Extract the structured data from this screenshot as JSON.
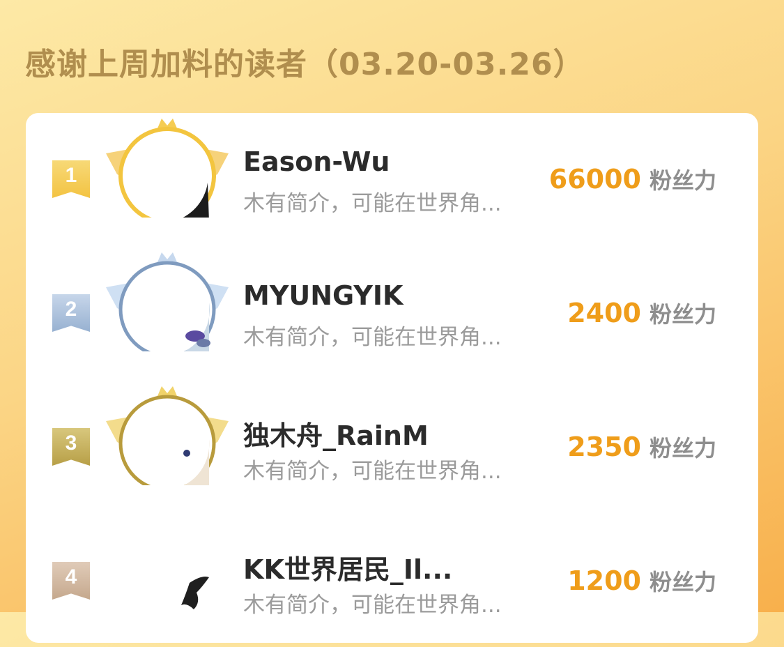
{
  "header": {
    "title": "感谢上周加料的读者（03.20-03.26）"
  },
  "colors": {
    "accent": "#ef9d1a",
    "title": "#b08e4e"
  },
  "readers": [
    {
      "rank": "1",
      "name": "Eason-Wu",
      "bio": "木有简介，可能在世界角...",
      "fans": "66000",
      "fans_unit": "粉丝力"
    },
    {
      "rank": "2",
      "name": "MYUNGYIK",
      "bio": "木有简介，可能在世界角...",
      "fans": "2400",
      "fans_unit": "粉丝力"
    },
    {
      "rank": "3",
      "name": "独木舟_RainM",
      "bio": "木有简介，可能在世界角...",
      "fans": "2350",
      "fans_unit": "粉丝力"
    },
    {
      "rank": "4",
      "name": "KK世界居民_Il...",
      "bio": "木有简介，可能在世界角...",
      "fans": "1200",
      "fans_unit": "粉丝力"
    }
  ]
}
